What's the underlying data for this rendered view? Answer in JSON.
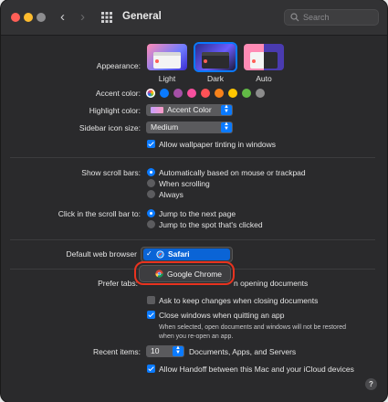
{
  "window": {
    "title": "General"
  },
  "search": {
    "placeholder": "Search"
  },
  "traffic_colors": {
    "close": "#ff5f57",
    "minimize": "#febc2e",
    "zoom": "#8d8d8f"
  },
  "appearance": {
    "label": "Appearance:",
    "options": [
      {
        "name": "Light",
        "selected": false
      },
      {
        "name": "Dark",
        "selected": true
      },
      {
        "name": "Auto",
        "selected": false
      }
    ]
  },
  "accent_color": {
    "label": "Accent color:",
    "colors": [
      "multicolor",
      "#0a7aff",
      "#a550a7",
      "#f74f9e",
      "#ff5257",
      "#f7821b",
      "#ffc600",
      "#62ba46",
      "#8c8c8c"
    ]
  },
  "highlight_color": {
    "label": "Highlight color:",
    "value": "Accent Color"
  },
  "sidebar_icon_size": {
    "label": "Sidebar icon size:",
    "value": "Medium"
  },
  "wallpaper_tinting": {
    "label": "Allow wallpaper tinting in windows",
    "checked": true
  },
  "scroll_bars": {
    "label": "Show scroll bars:",
    "options": [
      {
        "label": "Automatically based on mouse or trackpad",
        "selected": true
      },
      {
        "label": "When scrolling",
        "selected": false
      },
      {
        "label": "Always",
        "selected": false
      }
    ]
  },
  "scroll_click": {
    "label": "Click in the scroll bar to:",
    "options": [
      {
        "label": "Jump to the next page",
        "selected": true
      },
      {
        "label": "Jump to the spot that's clicked",
        "selected": false
      }
    ]
  },
  "default_browser": {
    "label": "Default web browser",
    "menu_items": [
      {
        "label": "Safari",
        "checked": true
      },
      {
        "label": "Google Chrome",
        "checked": false
      }
    ]
  },
  "prefer_tabs": {
    "label": "Prefer tabs:",
    "trailing_text": "n opening documents"
  },
  "ask_keep_changes": {
    "label": "Ask to keep changes when closing documents",
    "checked": false
  },
  "close_windows": {
    "label": "Close windows when quitting an app",
    "checked": true,
    "note_line1": "When selected, open documents and windows will not be restored",
    "note_line2": "when you re-open an app."
  },
  "recent_items": {
    "label": "Recent items:",
    "value": "10",
    "suffix": "Documents, Apps, and Servers"
  },
  "handoff": {
    "label": "Allow Handoff between this Mac and your iCloud devices",
    "checked": true
  },
  "help": {
    "label": "?"
  }
}
